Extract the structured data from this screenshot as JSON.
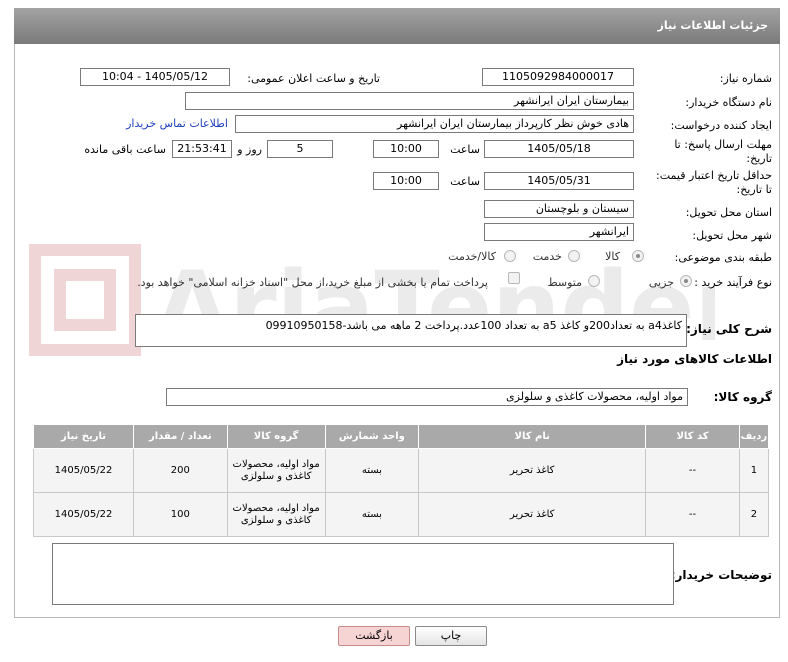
{
  "header": {
    "title": "جزئیات اطلاعات نیاز"
  },
  "fields": {
    "need_number_label": "شماره نیاز:",
    "need_number": "1105092984000017",
    "announce_label": "تاریخ و ساعت اعلان عمومی:",
    "announce_value": "1405/05/12 - 10:04",
    "buyer_org_label": "نام دستگاه خریدار:",
    "buyer_org": "بیمارستان ایران ایرانشهر",
    "creator_label": "ایجاد کننده درخواست:",
    "creator": "هادی خوش نظر کارپرداز بیمارستان ایران ایرانشهر",
    "buyer_contact_link": "اطلاعات تماس خریدار",
    "deadline_label_1": "مهلت ارسال پاسخ: تا",
    "deadline_label_2": "تاریخ:",
    "deadline_date": "1405/05/18",
    "time_label": "ساعت",
    "deadline_time": "10:00",
    "days_value": "5",
    "days_label": "روز و",
    "remaining_time": "21:53:41",
    "remaining_label": "ساعت باقی مانده",
    "validity_label_1": "حداقل تاریخ اعتبار قیمت:",
    "validity_label_2": "تا تاریخ:",
    "validity_date": "1405/05/31",
    "validity_time": "10:00",
    "province_label": "استان محل تحویل:",
    "province": "سیستان و بلوچستان",
    "city_label": "شهر محل تحویل:",
    "city": "ایرانشهر",
    "category_label": "طبقه بندی موضوعی:",
    "category_options": [
      "کالا",
      "خدمت",
      "کالا/خدمت"
    ],
    "process_label": "نوع فرآیند خرید :",
    "process_options": [
      "جزیی",
      "متوسط"
    ],
    "treasury_note": "پرداخت تمام یا بخشی از مبلغ خرید،از محل \"اسناد خزانه اسلامی\" خواهد بود.",
    "description_label": "شرح کلی نیاز:",
    "description": "کاغذa4 به تعداد200و کاغذ a5 به تعداد 100عدد.پرداخت 2 ماهه می باشد-09910950158",
    "goods_info_title": "اطلاعات کالاهای مورد نیاز",
    "goods_group_label": "گروه کالا:",
    "goods_group": "مواد اولیه، محصولات کاغذی و سلولزی",
    "buyer_notes_label": "توضیحات خریدار:",
    "buyer_notes": ""
  },
  "watermark": {
    "text": "AriaTender.neT"
  },
  "table": {
    "headers": [
      "ردیف",
      "کد کالا",
      "نام کالا",
      "واحد شمارش",
      "گروه کالا",
      "تعداد / مقدار",
      "تاریخ نیاز"
    ],
    "rows": [
      {
        "index": "1",
        "code": "--",
        "name": "کاغذ تحریر",
        "unit": "بسته",
        "group": "مواد اولیه، محصولات کاغذی و سلولزی",
        "qty": "200",
        "date": "1405/05/22"
      },
      {
        "index": "2",
        "code": "--",
        "name": "کاغذ تحریر",
        "unit": "بسته",
        "group": "مواد اولیه، محصولات کاغذی و سلولزی",
        "qty": "100",
        "date": "1405/05/22"
      }
    ]
  },
  "buttons": {
    "print": "چاپ",
    "back": "بازگشت"
  }
}
